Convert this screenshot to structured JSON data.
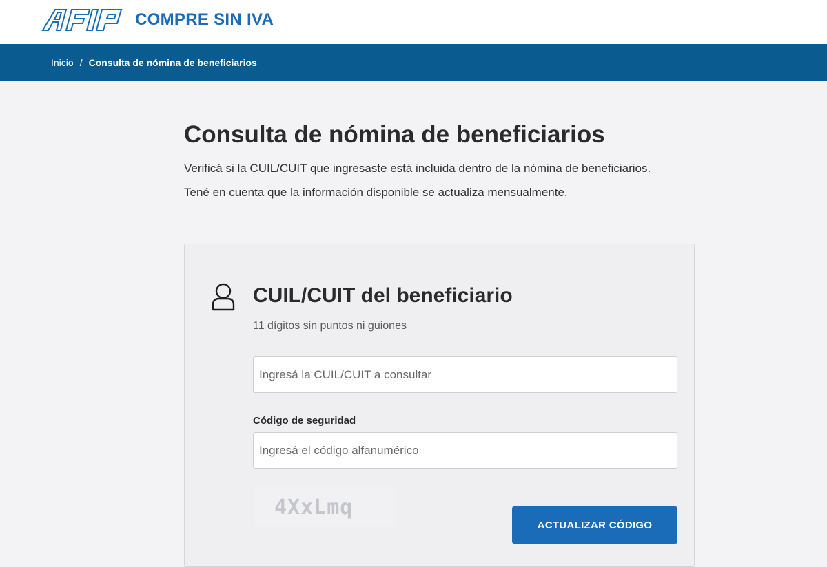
{
  "header": {
    "logo": "AFIP",
    "site_title": "COMPRE SIN IVA"
  },
  "breadcrumb": {
    "home": "Inicio",
    "separator": "/",
    "current": "Consulta de nómina de beneficiarios"
  },
  "main": {
    "title": "Consulta de nómina de beneficiarios",
    "intro_1": "Verificá si la CUIL/CUIT que ingresaste está incluida dentro de la nómina de beneficiarios.",
    "intro_2": "Tené en cuenta que la información disponible se actualiza mensualmente."
  },
  "form": {
    "icon": "user-icon",
    "title": "CUIL/CUIT del beneficiario",
    "subtitle": "11 dígitos sin puntos ni guiones",
    "cuil_value": "",
    "cuil_placeholder": "Ingresá la CUIL/CUIT a consultar",
    "code_label": "Código de seguridad",
    "code_value": "",
    "code_placeholder": "Ingresá el código alfanumérico",
    "captcha_text": "4XxLmq",
    "refresh_button": "ACTUALIZAR CÓDIGO"
  },
  "colors": {
    "brand_blue": "#1a6bb8",
    "breadcrumb_bg": "#0a5b8f",
    "page_bg": "#f3f3f5"
  }
}
